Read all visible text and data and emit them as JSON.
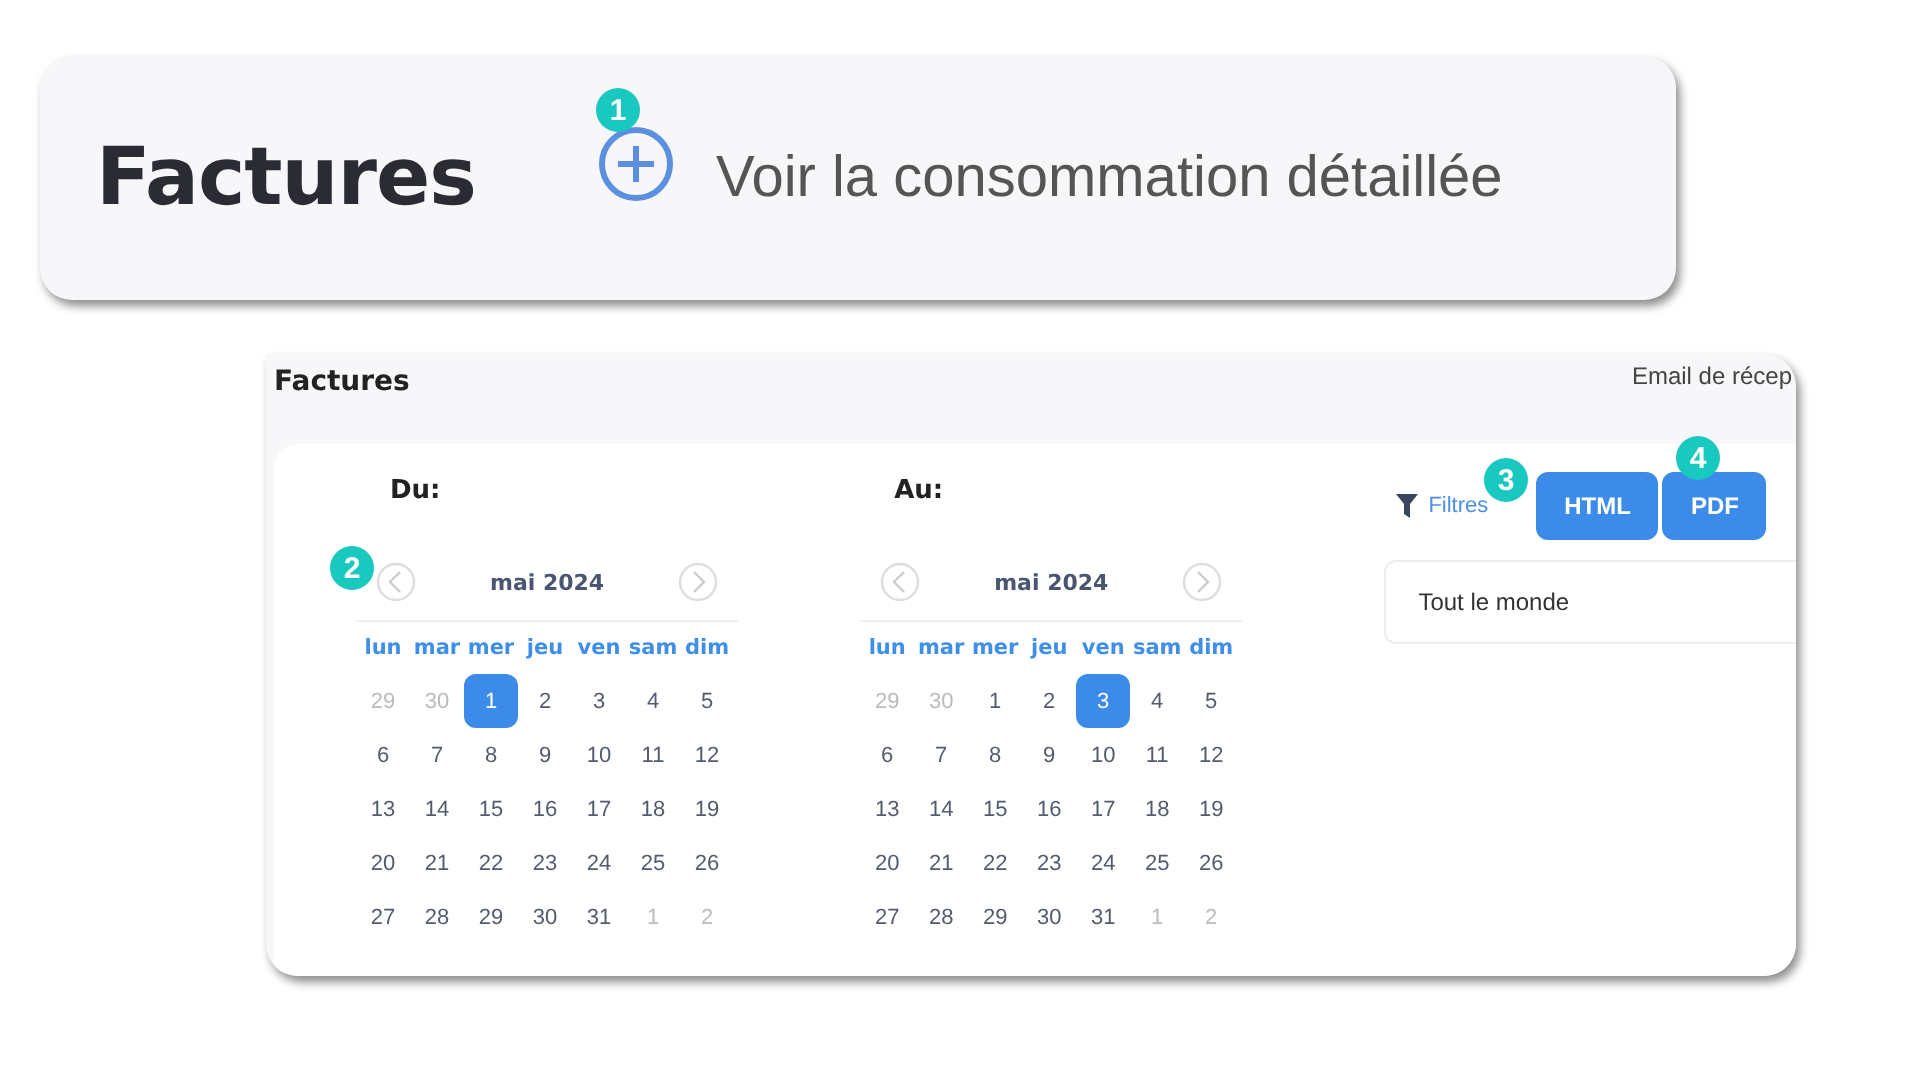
{
  "top_panel": {
    "title": "Factures",
    "link": "Voir la consommation détaillée"
  },
  "callouts": [
    "1",
    "2",
    "3",
    "4"
  ],
  "invoices_panel": {
    "title": "Factures",
    "email_label": "Email de récep",
    "calendars": [
      {
        "label": "Du:",
        "month": "mai 2024",
        "weekdays": [
          "lun",
          "mar",
          "mer",
          "jeu",
          "ven",
          "sam",
          "dim"
        ],
        "weeks": [
          [
            {
              "day": "29",
              "muted": true,
              "selected": false
            },
            {
              "day": "30",
              "muted": true,
              "selected": false
            },
            {
              "day": "1",
              "muted": false,
              "selected": true
            },
            {
              "day": "2",
              "muted": false,
              "selected": false
            },
            {
              "day": "3",
              "muted": false,
              "selected": false
            },
            {
              "day": "4",
              "muted": false,
              "selected": false
            },
            {
              "day": "5",
              "muted": false,
              "selected": false
            }
          ],
          [
            {
              "day": "6",
              "muted": false,
              "selected": false
            },
            {
              "day": "7",
              "muted": false,
              "selected": false
            },
            {
              "day": "8",
              "muted": false,
              "selected": false
            },
            {
              "day": "9",
              "muted": false,
              "selected": false
            },
            {
              "day": "10",
              "muted": false,
              "selected": false
            },
            {
              "day": "11",
              "muted": false,
              "selected": false
            },
            {
              "day": "12",
              "muted": false,
              "selected": false
            }
          ],
          [
            {
              "day": "13",
              "muted": false,
              "selected": false
            },
            {
              "day": "14",
              "muted": false,
              "selected": false
            },
            {
              "day": "15",
              "muted": false,
              "selected": false
            },
            {
              "day": "16",
              "muted": false,
              "selected": false
            },
            {
              "day": "17",
              "muted": false,
              "selected": false
            },
            {
              "day": "18",
              "muted": false,
              "selected": false
            },
            {
              "day": "19",
              "muted": false,
              "selected": false
            }
          ],
          [
            {
              "day": "20",
              "muted": false,
              "selected": false
            },
            {
              "day": "21",
              "muted": false,
              "selected": false
            },
            {
              "day": "22",
              "muted": false,
              "selected": false
            },
            {
              "day": "23",
              "muted": false,
              "selected": false
            },
            {
              "day": "24",
              "muted": false,
              "selected": false
            },
            {
              "day": "25",
              "muted": false,
              "selected": false
            },
            {
              "day": "26",
              "muted": false,
              "selected": false
            }
          ],
          [
            {
              "day": "27",
              "muted": false,
              "selected": false
            },
            {
              "day": "28",
              "muted": false,
              "selected": false
            },
            {
              "day": "29",
              "muted": false,
              "selected": false
            },
            {
              "day": "30",
              "muted": false,
              "selected": false
            },
            {
              "day": "31",
              "muted": false,
              "selected": false
            },
            {
              "day": "1",
              "muted": true,
              "selected": false
            },
            {
              "day": "2",
              "muted": true,
              "selected": false
            }
          ]
        ]
      },
      {
        "label": "Au:",
        "month": "mai 2024",
        "weekdays": [
          "lun",
          "mar",
          "mer",
          "jeu",
          "ven",
          "sam",
          "dim"
        ],
        "weeks": [
          [
            {
              "day": "29",
              "muted": true,
              "selected": false
            },
            {
              "day": "30",
              "muted": true,
              "selected": false
            },
            {
              "day": "1",
              "muted": false,
              "selected": false
            },
            {
              "day": "2",
              "muted": false,
              "selected": false
            },
            {
              "day": "3",
              "muted": false,
              "selected": true
            },
            {
              "day": "4",
              "muted": false,
              "selected": false
            },
            {
              "day": "5",
              "muted": false,
              "selected": false
            }
          ],
          [
            {
              "day": "6",
              "muted": false,
              "selected": false
            },
            {
              "day": "7",
              "muted": false,
              "selected": false
            },
            {
              "day": "8",
              "muted": false,
              "selected": false
            },
            {
              "day": "9",
              "muted": false,
              "selected": false
            },
            {
              "day": "10",
              "muted": false,
              "selected": false
            },
            {
              "day": "11",
              "muted": false,
              "selected": false
            },
            {
              "day": "12",
              "muted": false,
              "selected": false
            }
          ],
          [
            {
              "day": "13",
              "muted": false,
              "selected": false
            },
            {
              "day": "14",
              "muted": false,
              "selected": false
            },
            {
              "day": "15",
              "muted": false,
              "selected": false
            },
            {
              "day": "16",
              "muted": false,
              "selected": false
            },
            {
              "day": "17",
              "muted": false,
              "selected": false
            },
            {
              "day": "18",
              "muted": false,
              "selected": false
            },
            {
              "day": "19",
              "muted": false,
              "selected": false
            }
          ],
          [
            {
              "day": "20",
              "muted": false,
              "selected": false
            },
            {
              "day": "21",
              "muted": false,
              "selected": false
            },
            {
              "day": "22",
              "muted": false,
              "selected": false
            },
            {
              "day": "23",
              "muted": false,
              "selected": false
            },
            {
              "day": "24",
              "muted": false,
              "selected": false
            },
            {
              "day": "25",
              "muted": false,
              "selected": false
            },
            {
              "day": "26",
              "muted": false,
              "selected": false
            }
          ],
          [
            {
              "day": "27",
              "muted": false,
              "selected": false
            },
            {
              "day": "28",
              "muted": false,
              "selected": false
            },
            {
              "day": "29",
              "muted": false,
              "selected": false
            },
            {
              "day": "30",
              "muted": false,
              "selected": false
            },
            {
              "day": "31",
              "muted": false,
              "selected": false
            },
            {
              "day": "1",
              "muted": true,
              "selected": false
            },
            {
              "day": "2",
              "muted": true,
              "selected": false
            }
          ]
        ]
      }
    ],
    "filters": "Filtres",
    "buttons": [
      "HTML",
      "PDF"
    ],
    "audience": "Tout le monde"
  }
}
